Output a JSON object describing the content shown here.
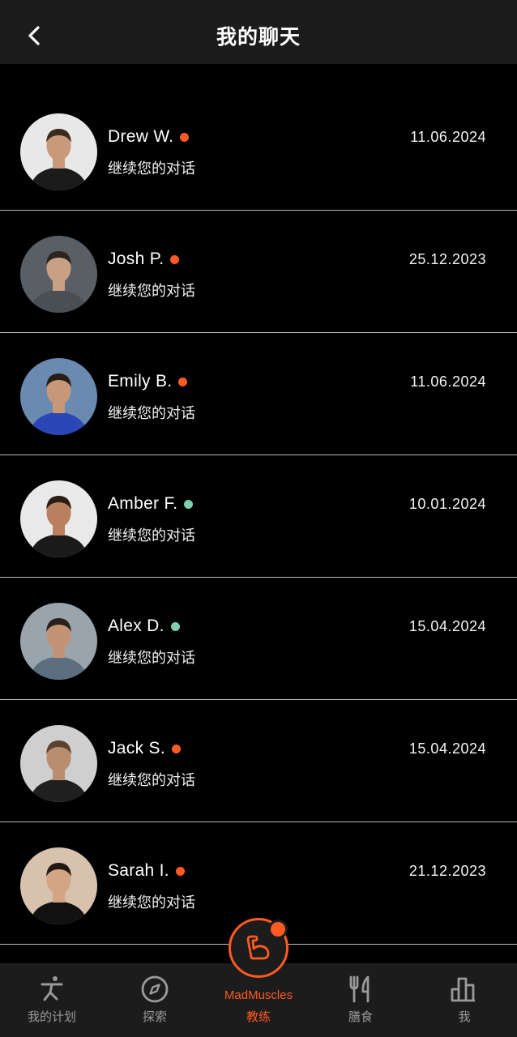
{
  "header": {
    "title": "我的聊天",
    "back_icon": "chevron-left-icon"
  },
  "colors": {
    "accent": "#ff5a22",
    "offline_dot": "#ff5a22",
    "online_dot": "#7ecfb0",
    "header_bg": "#1c1c1c"
  },
  "chats": [
    {
      "name": "Drew W.",
      "subtitle": "继续您的对话",
      "date": "11.06.2024",
      "status": "orange"
    },
    {
      "name": "Josh P.",
      "subtitle": "继续您的对话",
      "date": "25.12.2023",
      "status": "orange"
    },
    {
      "name": "Emily B.",
      "subtitle": "继续您的对话",
      "date": "11.06.2024",
      "status": "orange"
    },
    {
      "name": "Amber F.",
      "subtitle": "继续您的对话",
      "date": "10.01.2024",
      "status": "green"
    },
    {
      "name": "Alex D.",
      "subtitle": "继续您的对话",
      "date": "15.04.2024",
      "status": "green"
    },
    {
      "name": "Jack S.",
      "subtitle": "继续您的对话",
      "date": "15.04.2024",
      "status": "orange"
    },
    {
      "name": "Sarah I.",
      "subtitle": "继续您的对话",
      "date": "21.12.2023",
      "status": "orange"
    }
  ],
  "tabbar": {
    "tabs": [
      {
        "label": "我的计划",
        "icon": "workout-figure-icon"
      },
      {
        "label": "探索",
        "icon": "compass-icon"
      },
      {
        "label": "膳食",
        "icon": "fork-knife-icon"
      },
      {
        "label": "我",
        "icon": "bar-chart-icon"
      }
    ],
    "center": {
      "brand": "MadMuscles",
      "label": "教练",
      "icon": "flexed-arm-icon"
    }
  }
}
